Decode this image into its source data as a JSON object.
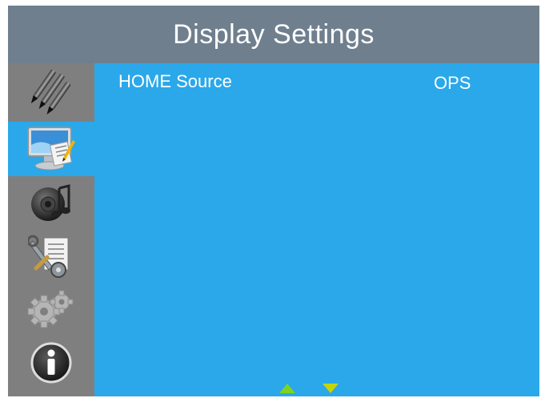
{
  "header": {
    "title": "Display Settings"
  },
  "sidebar": {
    "items": [
      {
        "icon": "pencils-icon",
        "active": false
      },
      {
        "icon": "monitor-edit-icon",
        "active": true
      },
      {
        "icon": "speaker-music-icon",
        "active": false
      },
      {
        "icon": "tools-document-icon",
        "active": false
      },
      {
        "icon": "gears-icon",
        "active": false
      },
      {
        "icon": "info-icon",
        "active": false
      }
    ]
  },
  "main": {
    "rows": [
      {
        "label": "HOME Source",
        "value": "OPS"
      }
    ]
  },
  "nav": {
    "up_icon": "arrow-up-icon",
    "down_icon": "arrow-down-icon"
  },
  "colors": {
    "title_bar": "#6f7f8e",
    "sidebar": "#7f7f7f",
    "accent": "#2aa8ea",
    "arrow_up": "#7ed321",
    "arrow_down": "#c8d400"
  }
}
